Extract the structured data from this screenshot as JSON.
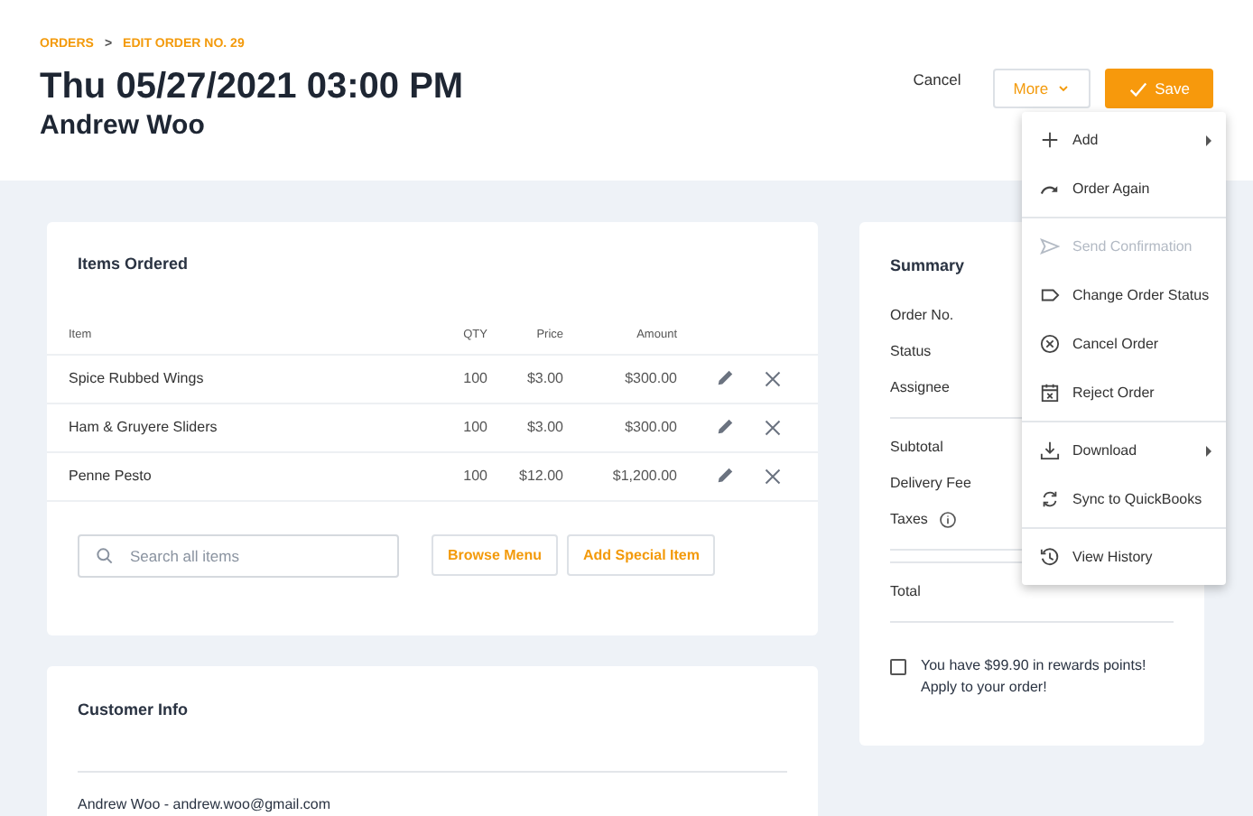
{
  "breadcrumb": [
    {
      "label": "ORDERS"
    },
    {
      "label": "EDIT ORDER NO. 29"
    }
  ],
  "breadcrumb_separator": ">",
  "title": "Thu 05/27/2021 03:00 PM",
  "subtitle": "Andrew Woo",
  "actions": {
    "cancel": "Cancel",
    "more": "More",
    "save": "Save"
  },
  "items_card": {
    "title": "Items Ordered",
    "columns": [
      "Item",
      "QTY",
      "Price",
      "Amount"
    ],
    "rows": [
      {
        "item": "Spice Rubbed Wings",
        "qty": "100",
        "price": "$3.00",
        "amount": "$300.00"
      },
      {
        "item": "Ham & Gruyere Sliders",
        "qty": "100",
        "price": "$3.00",
        "amount": "$300.00"
      },
      {
        "item": "Penne Pesto",
        "qty": "100",
        "price": "$12.00",
        "amount": "$1,200.00"
      }
    ],
    "search": {
      "placeholder": "Search all items"
    },
    "buttons": [
      "Browse Menu",
      "Add Special Item"
    ]
  },
  "customer_card": {
    "title": "Customer Info",
    "line": "Andrew Woo - andrew.woo@gmail.com"
  },
  "summary": {
    "title": "Summary",
    "groups": [
      [
        {
          "label": "Order No.",
          "info": false
        },
        {
          "label": "Status",
          "info": false
        },
        {
          "label": "Assignee",
          "info": false
        }
      ],
      [
        {
          "label": "Subtotal",
          "info": false
        },
        {
          "label": "Delivery Fee",
          "info": false
        },
        {
          "label": "Taxes",
          "info": true
        }
      ],
      [
        {
          "label": "Total",
          "info": false
        }
      ]
    ],
    "rewards": {
      "text": "You have $99.90 in rewards points! Apply to your order!",
      "checked": false
    }
  },
  "menu": {
    "groups": [
      [
        {
          "label": "Add",
          "kind": "plus",
          "submenu": true,
          "disabled": false
        },
        {
          "label": "Order Again",
          "kind": "redo",
          "submenu": false,
          "disabled": false
        }
      ],
      [
        {
          "label": "Send Confirmation",
          "kind": "send",
          "submenu": false,
          "disabled": true
        },
        {
          "label": "Change Order Status",
          "kind": "tag",
          "submenu": false,
          "disabled": false
        },
        {
          "label": "Cancel Order",
          "kind": "xcircle",
          "submenu": false,
          "disabled": false
        },
        {
          "label": "Reject Order",
          "kind": "calendar",
          "submenu": false,
          "disabled": false
        }
      ],
      [
        {
          "label": "Download",
          "kind": "download",
          "submenu": true,
          "disabled": false
        },
        {
          "label": "Sync to QuickBooks",
          "kind": "sync",
          "submenu": false,
          "disabled": false
        }
      ],
      [
        {
          "label": "View History",
          "kind": "history",
          "submenu": false,
          "disabled": false
        }
      ]
    ]
  }
}
